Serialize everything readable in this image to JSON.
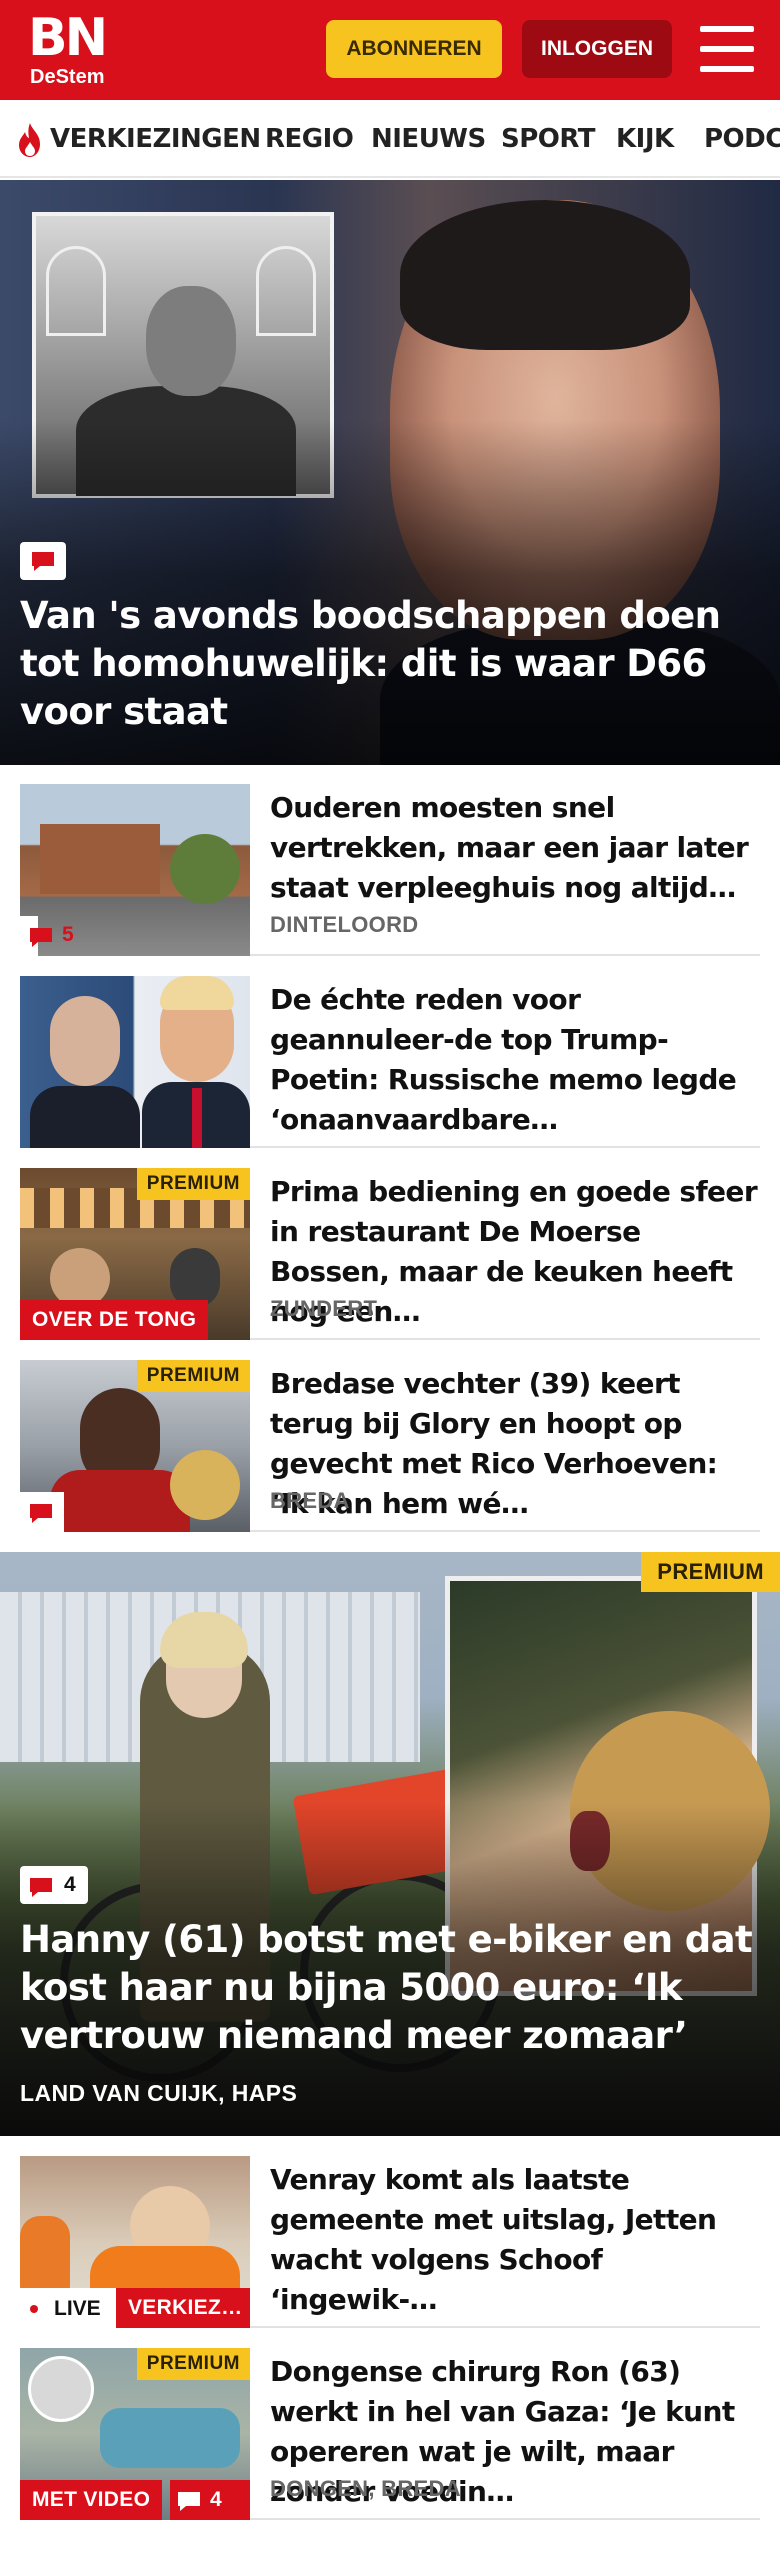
{
  "brand": {
    "logo_main": "BN",
    "logo_sub": "DeStem",
    "color": "#d8101b"
  },
  "header": {
    "subscribe_label": "ABONNEREN",
    "login_label": "INLOGGEN"
  },
  "nav": {
    "items": [
      "VERKIEZINGEN",
      "REGIO",
      "NIEUWS",
      "SPORT",
      "KIJK",
      "PODC"
    ]
  },
  "hero": {
    "title": "Van 's avonds boodschappen doen tot homohuwelijk: dit is waar D66 voor staat"
  },
  "list1": [
    {
      "title": "Ouderen moesten snel vertrekken, maar een jaar later staat verpleeghuis nog altijd…",
      "place": "DINTELOORD",
      "comments": "5"
    },
    {
      "title": "De échte reden voor geannuleer-de top Trump-Poetin: Russische memo legde ‘onaanvaardbare…",
      "place": ""
    },
    {
      "title": "Prima bediening en goede sfeer in restaurant De Moerse Bossen, maar de keuken heeft nog een…",
      "place": "ZUNDERT",
      "badge": "PREMIUM",
      "label": "OVER DE TONG"
    },
    {
      "title": "Bredase vechter (39) keert terug bij Glory en hoopt op gevecht met Rico Verhoeven: ‘Ik kan hem wé…",
      "place": "BREDA",
      "badge": "PREMIUM"
    }
  ],
  "hero2": {
    "badge": "PREMIUM",
    "comments": "4",
    "title": "Hanny (61) botst met e-biker en dat kost haar nu bijna 5000 euro: ‘Ik vertrouw niemand meer zomaar’",
    "place": "LAND VAN CUIJK, HAPS"
  },
  "list2": [
    {
      "title": "Venray komt als laatste gemeente met uitslag, Jetten wacht volgens Schoof ‘ingewik-…",
      "live": "LIVE",
      "label": "VERKIEZ…"
    },
    {
      "title": "Dongense chirurg Ron (63) werkt in hel van Gaza: ‘Je kunt opereren wat je wilt, maar zonder voedin…",
      "place": "DONGEN, BREDA",
      "badge": "PREMIUM",
      "label": "MET VIDEO",
      "comments": "4"
    }
  ]
}
